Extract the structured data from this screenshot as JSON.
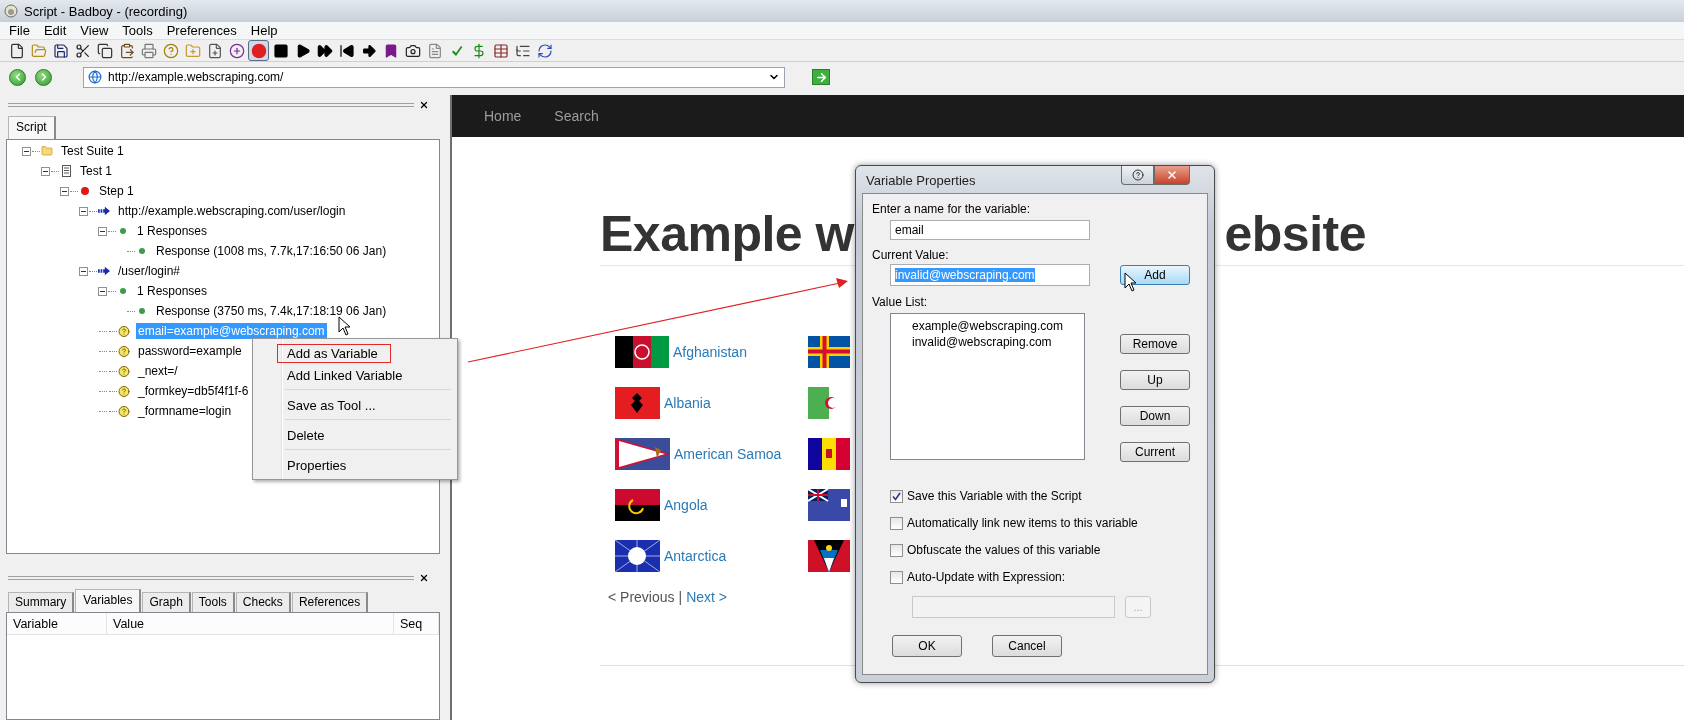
{
  "window": {
    "title": "Script - Badboy - (recording)"
  },
  "menu": [
    "File",
    "Edit",
    "View",
    "Tools",
    "Preferences",
    "Help"
  ],
  "toolbar": [
    {
      "kind": "new",
      "pressed": false
    },
    {
      "kind": "open",
      "pressed": false
    },
    {
      "kind": "save",
      "pressed": false
    },
    {
      "kind": "cut",
      "pressed": false
    },
    {
      "kind": "copy",
      "pressed": false
    },
    {
      "kind": "paste",
      "pressed": false
    },
    {
      "kind": "print",
      "pressed": false
    },
    {
      "kind": "help",
      "pressed": false
    },
    {
      "kind": "suite",
      "pressed": false
    },
    {
      "kind": "test",
      "pressed": false
    },
    {
      "kind": "step",
      "pressed": false
    },
    {
      "kind": "record",
      "pressed": true
    },
    {
      "kind": "stop",
      "pressed": false
    },
    {
      "kind": "play",
      "pressed": false
    },
    {
      "kind": "play_all",
      "pressed": false
    },
    {
      "kind": "rewind",
      "pressed": false
    },
    {
      "kind": "navigate",
      "pressed": false
    },
    {
      "kind": "bookmark",
      "pressed": false
    },
    {
      "kind": "screenshot",
      "pressed": false
    },
    {
      "kind": "report",
      "pressed": false
    },
    {
      "kind": "check",
      "pressed": false
    },
    {
      "kind": "variable",
      "pressed": false
    },
    {
      "kind": "table",
      "pressed": false
    },
    {
      "kind": "tree",
      "pressed": false
    },
    {
      "kind": "refresh",
      "pressed": false
    }
  ],
  "address_bar": {
    "url": "http://example.webscraping.com/"
  },
  "script_panel": {
    "tabs": [
      {
        "label": "Script",
        "selected": true
      }
    ],
    "tree": [
      {
        "label": "Test Suite 1",
        "kind": "suite",
        "expanded": true,
        "selected": false,
        "children": [
          {
            "label": "Test 1",
            "kind": "test",
            "expanded": true,
            "selected": false,
            "children": [
              {
                "label": "Step 1",
                "kind": "step",
                "expanded": true,
                "selected": false,
                "children": [
                  {
                    "label": "http://example.webscraping.com/user/login",
                    "kind": "request",
                    "expanded": true,
                    "selected": false,
                    "children": [
                      {
                        "label": "1 Responses",
                        "kind": "responses",
                        "expanded": true,
                        "selected": false,
                        "children": [
                          {
                            "label": "Response (1008 ms, 7.7k,17:16:50 06 Jan)",
                            "kind": "response",
                            "selected": false
                          }
                        ]
                      }
                    ]
                  },
                  {
                    "label": "/user/login#",
                    "kind": "request",
                    "expanded": true,
                    "selected": false,
                    "children": [
                      {
                        "label": "1 Responses",
                        "kind": "responses",
                        "expanded": true,
                        "selected": false,
                        "children": [
                          {
                            "label": "Response (3750 ms, 7.4k,17:18:19 06 Jan)",
                            "kind": "response",
                            "selected": false
                          }
                        ]
                      },
                      {
                        "label": "email=example@webscraping.com",
                        "kind": "param",
                        "selected": true
                      },
                      {
                        "label": "password=example",
                        "kind": "param",
                        "selected": false
                      },
                      {
                        "label": "_next=/",
                        "kind": "param",
                        "selected": false
                      },
                      {
                        "label": "_formkey=db5f4f1f-6",
                        "kind": "param",
                        "selected": false
                      },
                      {
                        "label": "_formname=login",
                        "kind": "param",
                        "selected": false
                      }
                    ]
                  }
                ]
              }
            ]
          }
        ]
      }
    ]
  },
  "context_menu": [
    {
      "kind": "item",
      "label": "Add as Variable",
      "outlined": true
    },
    {
      "kind": "item",
      "label": "Add Linked Variable",
      "outlined": false
    },
    {
      "kind": "separator"
    },
    {
      "kind": "item",
      "label": "Save as Tool ...",
      "outlined": false
    },
    {
      "kind": "separator"
    },
    {
      "kind": "item",
      "label": "Delete",
      "outlined": false
    },
    {
      "kind": "separator"
    },
    {
      "kind": "item",
      "label": "Properties",
      "outlined": false
    }
  ],
  "details_panel": {
    "tabs": [
      {
        "label": "Summary",
        "selected": false
      },
      {
        "label": "Variables",
        "selected": true
      },
      {
        "label": "Graph",
        "selected": false
      },
      {
        "label": "Tools",
        "selected": false
      },
      {
        "label": "Checks",
        "selected": false
      },
      {
        "label": "References",
        "selected": false
      }
    ],
    "columns": [
      "Variable",
      "Value",
      "Seq"
    ]
  },
  "browser": {
    "nav": [
      "Home",
      "Search"
    ],
    "heading_parts": [
      "Example w",
      "ebsite"
    ],
    "countries": [
      {
        "name": "Afghanistan"
      },
      {
        "name": "Albania"
      },
      {
        "name": "American Samoa"
      },
      {
        "name": "Angola"
      },
      {
        "name": "Antarctica"
      }
    ],
    "pager": {
      "previous": "< Previous",
      "separator": "|",
      "next": "Next >"
    }
  },
  "dialog": {
    "title": "Variable Properties",
    "name_label": "Enter a name for the variable:",
    "name_value": "email",
    "current_label": "Current Value:",
    "current_value": "invalid@webscraping.com",
    "current_value_selected": true,
    "add_button": {
      "label": "Add",
      "hovered": true
    },
    "list_label": "Value List:",
    "values": [
      "example@webscraping.com",
      "invalid@webscraping.com"
    ],
    "list_buttons": [
      "Remove",
      "Up",
      "Down",
      "Current"
    ],
    "options": [
      {
        "label": "Save this Variable with the Script",
        "checked": true
      },
      {
        "label": "Automatically link new items to this variable",
        "checked": false
      },
      {
        "label": "Obfuscate the values of this variable",
        "checked": false
      },
      {
        "label": "Auto-Update with Expression:",
        "checked": false
      }
    ],
    "browse_button": "...",
    "ok": "OK",
    "cancel": "Cancel"
  }
}
